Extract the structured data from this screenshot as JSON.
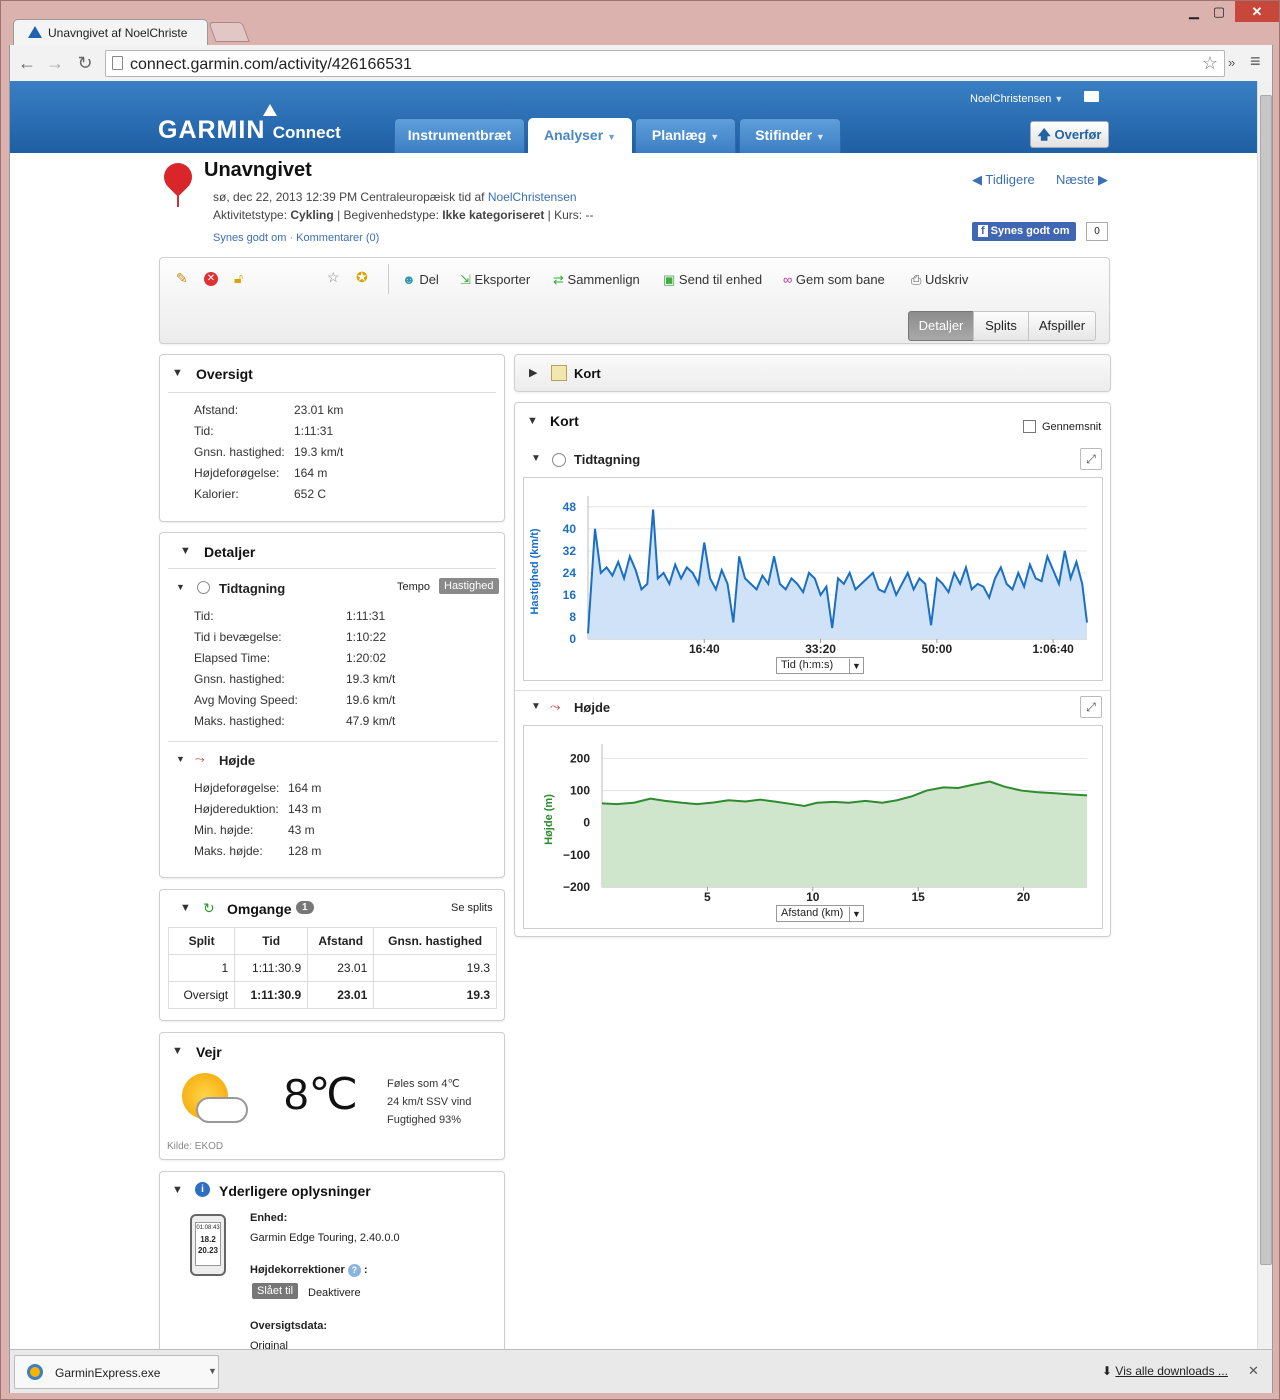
{
  "browser": {
    "tab_title": "Unavngivet af NoelChriste",
    "url": "connect.garmin.com/activity/426166531",
    "win_minimize": "▁",
    "win_maximize": "▢",
    "win_close": "✕"
  },
  "header": {
    "username": "NoelChristensen",
    "logo_garmin": "GARMIN",
    "logo_connect": "Connect",
    "nav": [
      {
        "label": "Instrumentbræt"
      },
      {
        "label": "Analyser"
      },
      {
        "label": "Planlæg"
      },
      {
        "label": "Stifinder"
      }
    ],
    "upload_label": "Overfør"
  },
  "activity": {
    "title": "Unavngivet",
    "date_line": "sø, dec 22, 2013 12:39 PM Centraleuropæisk tid af",
    "author": "NoelChristensen",
    "type_label": "Aktivitetstype:",
    "type_value": "Cykling",
    "event_label": "| Begivenhedstype:",
    "event_value": "Ikke kategoriseret",
    "course": "| Kurs: --",
    "like_link": "Synes godt om",
    "comment_link": "Kommentarer (0)",
    "prev": "Tidligere",
    "next": "Næste",
    "fb_like": "Synes godt om",
    "fb_count": "0"
  },
  "actions": {
    "share": "Del",
    "export": "Eksporter",
    "compare": "Sammenlign",
    "send": "Send til enhed",
    "save_course": "Gem som bane",
    "print": "Udskriv",
    "views": [
      "Detaljer",
      "Splits",
      "Afspiller"
    ]
  },
  "overview": {
    "title": "Oversigt",
    "rows": [
      {
        "label": "Afstand:",
        "value": "23.01 km"
      },
      {
        "label": "Tid:",
        "value": "1:11:31"
      },
      {
        "label": "Gnsn. hastighed:",
        "value": "19.3 km/t"
      },
      {
        "label": "Højdeforøgelse:",
        "value": "164 m"
      },
      {
        "label": "Kalorier:",
        "value": "652 C"
      }
    ]
  },
  "details": {
    "title": "Detaljer",
    "timing_title": "Tidtagning",
    "tempo": "Tempo",
    "speed": "Hastighed",
    "timing_rows": [
      {
        "label": "Tid:",
        "value": "1:11:31"
      },
      {
        "label": "Tid i bevægelse:",
        "value": "1:10:22"
      },
      {
        "label": "Elapsed Time:",
        "value": "1:20:02"
      },
      {
        "label": "Gnsn. hastighed:",
        "value": "19.3 km/t"
      },
      {
        "label": "Avg Moving Speed:",
        "value": "19.6 km/t"
      },
      {
        "label": "Maks. hastighed:",
        "value": "47.9 km/t"
      }
    ],
    "elev_title": "Højde",
    "elev_rows": [
      {
        "label": "Højdeforøgelse:",
        "value": "164 m"
      },
      {
        "label": "Højdereduktion:",
        "value": "143 m"
      },
      {
        "label": "Min. højde:",
        "value": "43 m"
      },
      {
        "label": "Maks. højde:",
        "value": "128 m"
      }
    ]
  },
  "laps": {
    "title": "Omgange",
    "count": "1",
    "see_splits": "Se splits",
    "headers": [
      "Split",
      "Tid",
      "Afstand",
      "Gnsn. hastighed"
    ],
    "rows": [
      [
        "1",
        "1:11:30.9",
        "23.01",
        "19.3"
      ],
      [
        "Oversigt",
        "1:11:30.9",
        "23.01",
        "19.3"
      ]
    ]
  },
  "weather": {
    "title": "Vejr",
    "temp": "8℃",
    "feels": "Føles som 4℃",
    "wind": "24 km/t SSV vind",
    "humidity": "Fugtighed 93%",
    "source": "Kilde: EKOD"
  },
  "more": {
    "title": "Yderligere oplysninger",
    "device_label": "Enhed:",
    "device_value": "Garmin Edge Touring, 2.40.0.0",
    "corr_label": "Højdekorrektioner",
    "corr_on": "Slået til",
    "corr_off": "Deaktivere",
    "summary_label": "Oversigtsdata:",
    "summary_value": "Original",
    "device_screen": [
      "01:08:43",
      "18.2",
      "20.23"
    ]
  },
  "map_panel": {
    "title": "Kort"
  },
  "charts_panel": {
    "title": "Kort",
    "average_label": "Gennemsnit",
    "timing_title": "Tidtagning",
    "elev_title": "Højde",
    "x1_select": "Tid (h:m:s)",
    "x2_select": "Afstand (km)"
  },
  "chart_data": [
    {
      "type": "area",
      "ylabel": "Hastighed (km/t)",
      "color": "#1a6fc4",
      "yticks": [
        0,
        8,
        16,
        24,
        32,
        40,
        48
      ],
      "ylim": [
        0,
        49
      ],
      "xticks": [
        {
          "v": 1000,
          "label": "16:40"
        },
        {
          "v": 2000,
          "label": "33:20"
        },
        {
          "v": 3000,
          "label": "50:00"
        },
        {
          "v": 4000,
          "label": "1:06:40"
        }
      ],
      "xlim": [
        0,
        4291
      ],
      "x": [
        0,
        60,
        110,
        160,
        210,
        260,
        310,
        360,
        410,
        460,
        510,
        560,
        600,
        650,
        700,
        750,
        800,
        850,
        900,
        950,
        1000,
        1050,
        1100,
        1150,
        1200,
        1250,
        1300,
        1350,
        1400,
        1450,
        1500,
        1550,
        1600,
        1650,
        1700,
        1750,
        1800,
        1850,
        1900,
        1950,
        2000,
        2050,
        2100,
        2150,
        2200,
        2250,
        2300,
        2350,
        2400,
        2450,
        2500,
        2550,
        2600,
        2650,
        2700,
        2750,
        2800,
        2850,
        2900,
        2950,
        3000,
        3050,
        3100,
        3150,
        3200,
        3250,
        3300,
        3350,
        3400,
        3450,
        3500,
        3550,
        3600,
        3650,
        3700,
        3750,
        3800,
        3850,
        3900,
        3950,
        4000,
        4050,
        4100,
        4150,
        4200,
        4250,
        4291
      ],
      "y": [
        2,
        40,
        24,
        26,
        23,
        28,
        22,
        30,
        25,
        18,
        20,
        47,
        22,
        24,
        20,
        27,
        22,
        26,
        24,
        20,
        35,
        22,
        18,
        25,
        20,
        6,
        30,
        22,
        20,
        18,
        23,
        20,
        30,
        20,
        18,
        22,
        20,
        17,
        24,
        22,
        16,
        19,
        4,
        22,
        20,
        24,
        18,
        20,
        22,
        24,
        18,
        17,
        22,
        16,
        20,
        24,
        18,
        22,
        20,
        5,
        22,
        20,
        17,
        24,
        20,
        26,
        18,
        20,
        19,
        15,
        22,
        26,
        20,
        18,
        24,
        19,
        27,
        22,
        21,
        30,
        25,
        20,
        32,
        22,
        28,
        20,
        6
      ]
    },
    {
      "type": "area",
      "ylabel": "Højde (m)",
      "color": "#2e8b2e",
      "yticks": [
        -200,
        -100,
        0,
        100,
        200
      ],
      "ylim": [
        -200,
        220
      ],
      "xticks": [
        {
          "v": 5,
          "label": "5"
        },
        {
          "v": 10,
          "label": "10"
        },
        {
          "v": 15,
          "label": "15"
        },
        {
          "v": 20,
          "label": "20"
        }
      ],
      "xlim": [
        0,
        23.01
      ],
      "x": [
        0,
        0.7,
        1.5,
        2.3,
        3.0,
        3.8,
        4.5,
        5.3,
        6.0,
        6.8,
        7.5,
        8.3,
        9.0,
        9.6,
        10.2,
        11.0,
        11.7,
        12.5,
        13.3,
        14.0,
        14.7,
        15.4,
        16.2,
        16.9,
        17.6,
        18.4,
        19.1,
        19.9,
        20.6,
        21.4,
        22.2,
        23.01
      ],
      "y": [
        60,
        58,
        62,
        75,
        68,
        62,
        58,
        63,
        70,
        66,
        72,
        65,
        58,
        52,
        62,
        65,
        62,
        68,
        62,
        70,
        82,
        100,
        110,
        108,
        118,
        128,
        112,
        100,
        95,
        92,
        88,
        85
      ]
    }
  ],
  "downloads": {
    "file": "GarminExpress.exe",
    "show_all": "Vis alle downloads ...",
    "close": "✕"
  }
}
